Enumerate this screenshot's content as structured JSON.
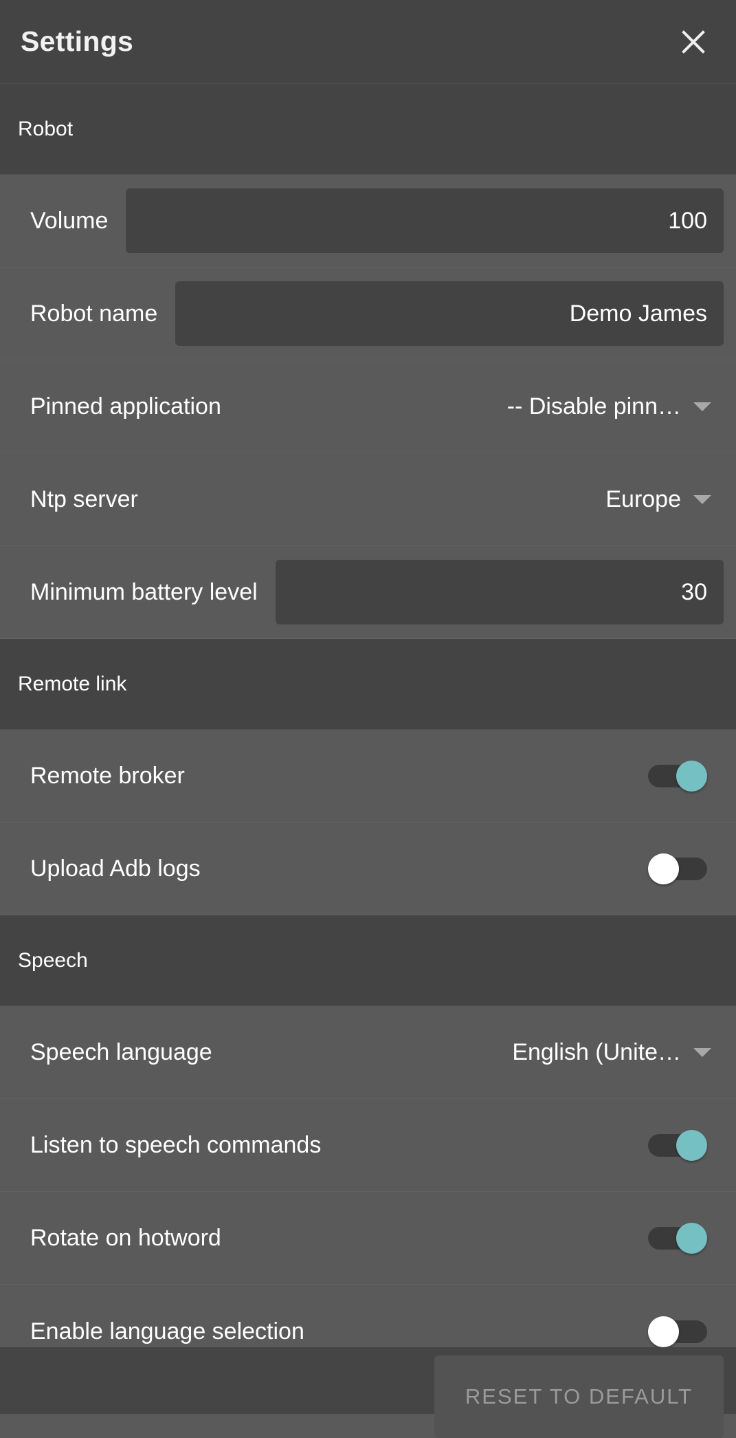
{
  "window": {
    "title": "Settings",
    "close_icon": "close-icon"
  },
  "theme": {
    "accent": "#75c0c2",
    "titlebar_bg": "#444444",
    "section_header_bg": "#444444",
    "row_bg": "#5a5a5a",
    "field_bg": "#434343",
    "text": "#ffffff",
    "muted_text": "#9b9b9b"
  },
  "sections": [
    {
      "title": "Robot",
      "rows": [
        {
          "label": "Volume",
          "type": "input",
          "value": "100"
        },
        {
          "label": "Robot name",
          "type": "input",
          "value": "Demo James"
        },
        {
          "label": "Pinned application",
          "type": "dropdown",
          "value": "-- Disable pinn…"
        },
        {
          "label": "Ntp server",
          "type": "dropdown",
          "value": "Europe"
        },
        {
          "label": "Minimum battery level",
          "type": "input",
          "value": "30"
        }
      ]
    },
    {
      "title": "Remote link",
      "rows": [
        {
          "label": "Remote broker",
          "type": "toggle",
          "value": "on"
        },
        {
          "label": "Upload Adb logs",
          "type": "toggle",
          "value": "off"
        }
      ]
    },
    {
      "title": "Speech",
      "rows": [
        {
          "label": "Speech language",
          "type": "dropdown",
          "value": "English (Unite…"
        },
        {
          "label": "Listen to speech commands",
          "type": "toggle",
          "value": "on"
        },
        {
          "label": "Rotate on hotword",
          "type": "toggle",
          "value": "on"
        },
        {
          "label": "Enable language selection",
          "type": "toggle",
          "value": "off"
        }
      ]
    }
  ],
  "footer": {
    "reset_label": "RESET TO DEFAULT"
  }
}
